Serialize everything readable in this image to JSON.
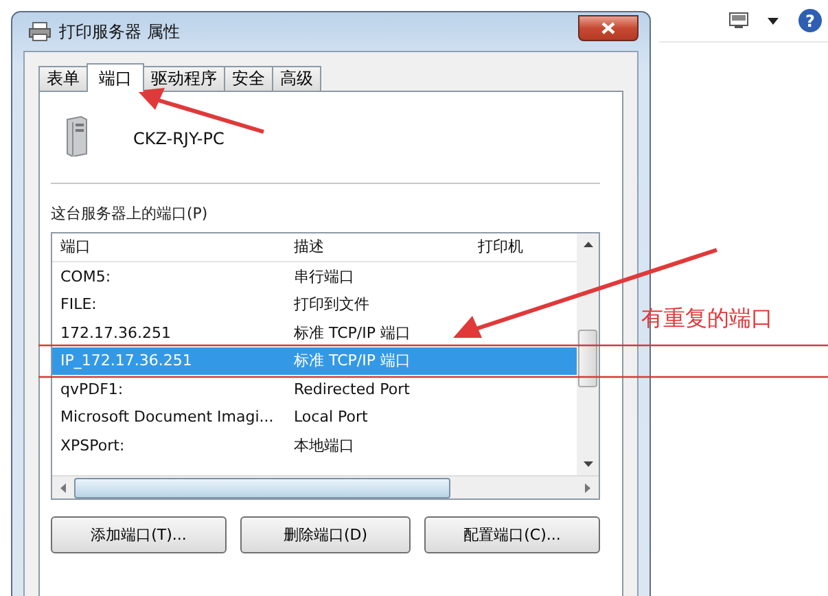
{
  "window": {
    "title": "打印服务器 属性"
  },
  "tabs": [
    {
      "label": "表单",
      "selected": false
    },
    {
      "label": "端口",
      "selected": true
    },
    {
      "label": "驱动程序",
      "selected": false
    },
    {
      "label": "安全",
      "selected": false
    },
    {
      "label": "高级",
      "selected": false
    }
  ],
  "server_name": "CKZ-RJY-PC",
  "ports_label": "这台服务器上的端口(P)",
  "table": {
    "columns": [
      "端口",
      "描述",
      "打印机"
    ],
    "rows": [
      {
        "port": "COM5:",
        "description": "串行端口",
        "selected": false
      },
      {
        "port": "FILE:",
        "description": "打印到文件",
        "selected": false
      },
      {
        "port": "172.17.36.251",
        "description": "标准 TCP/IP 端口",
        "selected": false
      },
      {
        "port": "IP_172.17.36.251",
        "description": "标准 TCP/IP 端口",
        "selected": true
      },
      {
        "port": "qvPDF1:",
        "description": "Redirected Port",
        "selected": false
      },
      {
        "port": "Microsoft Document Imagi...",
        "description": "Local Port",
        "selected": false
      },
      {
        "port": "XPSPort:",
        "description": "本地端口",
        "selected": false
      }
    ]
  },
  "buttons": [
    "添加端口(T)...",
    "删除端口(D)",
    "配置端口(C)..."
  ],
  "annotation": "有重复的端口",
  "help_icon": "?"
}
